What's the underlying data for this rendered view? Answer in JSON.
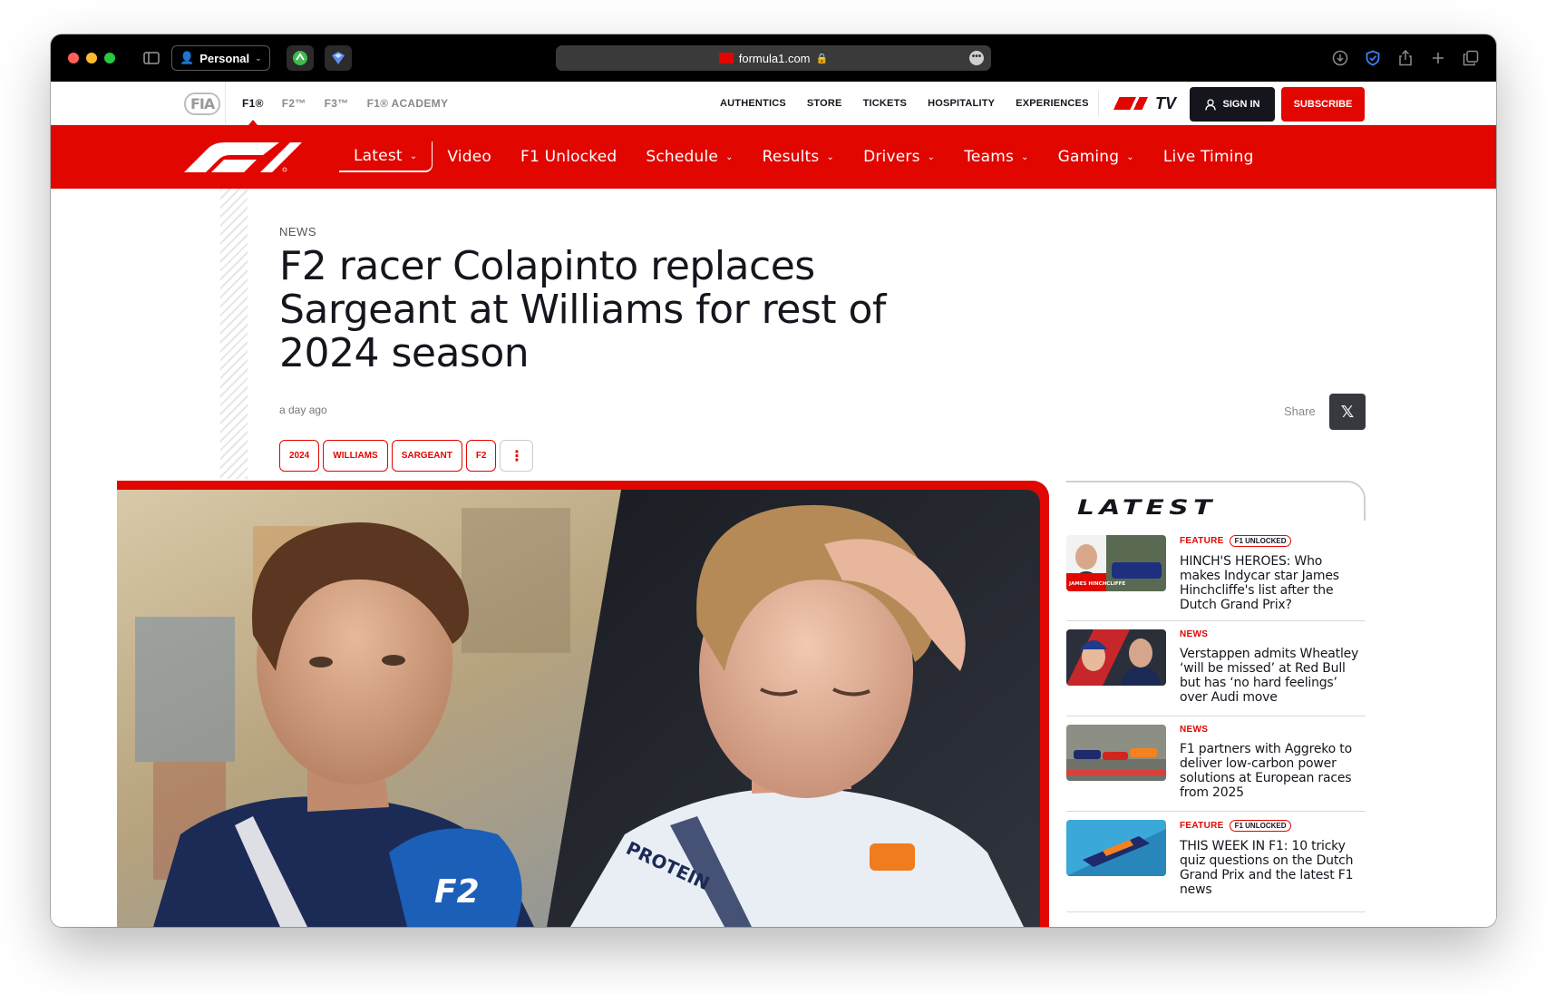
{
  "browser": {
    "profile": "Personal",
    "url": "formula1.com",
    "icons": [
      "sidebar-toggle-icon",
      "download-icon",
      "shield-icon",
      "share-icon",
      "new-tab-icon",
      "tabs-overview-icon"
    ]
  },
  "topbar": {
    "fia": "FIA",
    "series": [
      "F1®",
      "F2™",
      "F3™",
      "F1® ACADEMY"
    ],
    "links": [
      "AUTHENTICS",
      "STORE",
      "TICKETS",
      "HOSPITALITY",
      "EXPERIENCES"
    ],
    "tv_label": "TV",
    "signin": "SIGN IN",
    "subscribe": "SUBSCRIBE"
  },
  "nav": {
    "items": [
      "Latest",
      "Video",
      "F1 Unlocked",
      "Schedule",
      "Results",
      "Drivers",
      "Teams",
      "Gaming",
      "Live Timing"
    ]
  },
  "article": {
    "kicker": "NEWS",
    "headline": "F2 racer Colapinto replaces Sargeant at Williams for rest of 2024 season",
    "date": "a day ago",
    "share_label": "Share",
    "share_x": "𝕏",
    "tags": [
      "2024",
      "WILLIAMS",
      "SARGEANT",
      "F2"
    ],
    "more_tags": "⋮"
  },
  "latest": {
    "title": "LATEST",
    "stories": [
      {
        "category": "FEATURE",
        "badge": "F1 UNLOCKED",
        "title": "HINCH'S HEROES: Who makes Indycar star James Hinchcliffe's list after the Dutch Grand Prix?",
        "thumb_caption": "JAMES HINCHCLIFFE"
      },
      {
        "category": "NEWS",
        "badge": "",
        "title": "Verstappen admits Wheatley ‘will be missed’ at Red Bull but has ‘no hard feelings’ over Audi move"
      },
      {
        "category": "NEWS",
        "badge": "",
        "title": "F1 partners with Aggreko to deliver low-carbon power solutions at European races from 2025"
      },
      {
        "category": "FEATURE",
        "badge": "F1 UNLOCKED",
        "title": "THIS WEEK IN F1: 10 tricky quiz questions on the Dutch Grand Prix and the latest F1 news"
      }
    ]
  },
  "colors": {
    "f1_red": "#e10600",
    "dark": "#15151e"
  }
}
